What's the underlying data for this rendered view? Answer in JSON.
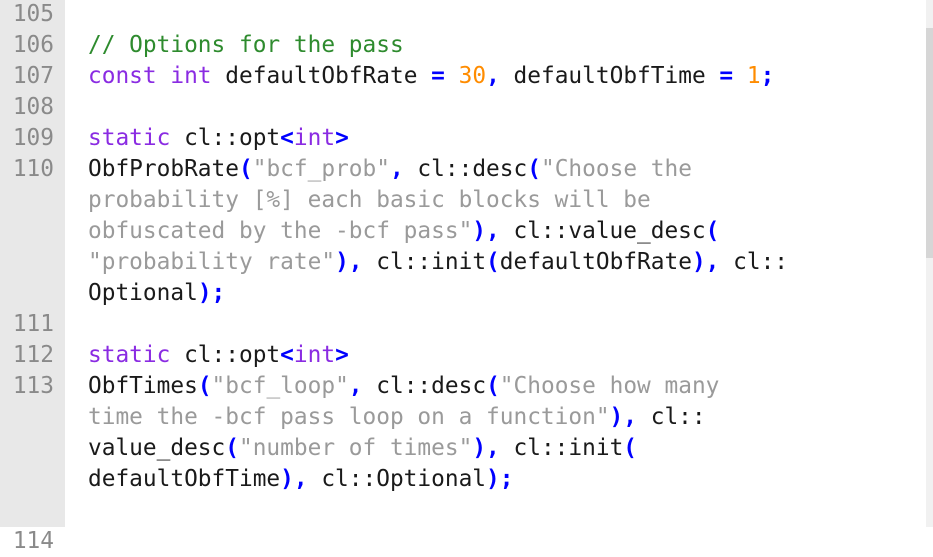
{
  "editor": {
    "lines": [
      {
        "number": "105",
        "tokens": []
      },
      {
        "number": "106",
        "tokens": [
          {
            "t": "cmt",
            "s": "// Options for the pass"
          }
        ]
      },
      {
        "number": "107",
        "tokens": [
          {
            "t": "kw",
            "s": "const"
          },
          {
            "t": "tx",
            "s": " "
          },
          {
            "t": "kw",
            "s": "int"
          },
          {
            "t": "tx",
            "s": " defaultObfRate "
          },
          {
            "t": "pn",
            "s": "="
          },
          {
            "t": "tx",
            "s": " "
          },
          {
            "t": "num",
            "s": "30"
          },
          {
            "t": "pn",
            "s": ","
          },
          {
            "t": "tx",
            "s": " defaultObfTime "
          },
          {
            "t": "pn",
            "s": "="
          },
          {
            "t": "tx",
            "s": " "
          },
          {
            "t": "num",
            "s": "1"
          },
          {
            "t": "pn",
            "s": ";"
          }
        ]
      },
      {
        "number": "108",
        "tokens": []
      },
      {
        "number": "109",
        "tokens": [
          {
            "t": "kw",
            "s": "static"
          },
          {
            "t": "tx",
            "s": " cl::opt"
          },
          {
            "t": "pn",
            "s": "<"
          },
          {
            "t": "kw",
            "s": "int"
          },
          {
            "t": "pn",
            "s": ">"
          }
        ]
      },
      {
        "number": "110",
        "tokens": [
          {
            "t": "tx",
            "s": "ObfProbRate"
          },
          {
            "t": "pn",
            "s": "("
          },
          {
            "t": "str",
            "s": "\"bcf_prob\""
          },
          {
            "t": "pn",
            "s": ","
          },
          {
            "t": "tx",
            "s": " cl::desc"
          },
          {
            "t": "pn",
            "s": "("
          },
          {
            "t": "str",
            "s": "\"Choose the"
          }
        ]
      },
      {
        "number": "",
        "tokens": [
          {
            "t": "str",
            "s": "probability [%] each basic blocks will be"
          }
        ]
      },
      {
        "number": "",
        "tokens": [
          {
            "t": "str",
            "s": "obfuscated by the -bcf pass\""
          },
          {
            "t": "pn",
            "s": "),"
          },
          {
            "t": "tx",
            "s": " cl::value_desc"
          },
          {
            "t": "pn",
            "s": "("
          }
        ]
      },
      {
        "number": "",
        "tokens": [
          {
            "t": "str",
            "s": "\"probability rate\""
          },
          {
            "t": "pn",
            "s": "),"
          },
          {
            "t": "tx",
            "s": " cl::init"
          },
          {
            "t": "pn",
            "s": "("
          },
          {
            "t": "tx",
            "s": "defaultObfRate"
          },
          {
            "t": "pn",
            "s": "),"
          },
          {
            "t": "tx",
            "s": " cl::"
          }
        ]
      },
      {
        "number": "",
        "tokens": [
          {
            "t": "tx",
            "s": "Optional"
          },
          {
            "t": "pn",
            "s": ");"
          }
        ]
      },
      {
        "number": "111",
        "tokens": []
      },
      {
        "number": "112",
        "tokens": [
          {
            "t": "kw",
            "s": "static"
          },
          {
            "t": "tx",
            "s": " cl::opt"
          },
          {
            "t": "pn",
            "s": "<"
          },
          {
            "t": "kw",
            "s": "int"
          },
          {
            "t": "pn",
            "s": ">"
          }
        ]
      },
      {
        "number": "113",
        "tokens": [
          {
            "t": "tx",
            "s": "ObfTimes"
          },
          {
            "t": "pn",
            "s": "("
          },
          {
            "t": "str",
            "s": "\"bcf_loop\""
          },
          {
            "t": "pn",
            "s": ","
          },
          {
            "t": "tx",
            "s": " cl::desc"
          },
          {
            "t": "pn",
            "s": "("
          },
          {
            "t": "str",
            "s": "\"Choose how many"
          }
        ]
      },
      {
        "number": "",
        "tokens": [
          {
            "t": "str",
            "s": "time the -bcf pass loop on a function\""
          },
          {
            "t": "pn",
            "s": "),"
          },
          {
            "t": "tx",
            "s": " cl::"
          }
        ]
      },
      {
        "number": "",
        "tokens": [
          {
            "t": "tx",
            "s": "value_desc"
          },
          {
            "t": "pn",
            "s": "("
          },
          {
            "t": "str",
            "s": "\"number of times\""
          },
          {
            "t": "pn",
            "s": "),"
          },
          {
            "t": "tx",
            "s": " cl::init"
          },
          {
            "t": "pn",
            "s": "("
          }
        ]
      },
      {
        "number": "",
        "tokens": [
          {
            "t": "tx",
            "s": "defaultObfTime"
          },
          {
            "t": "pn",
            "s": "),"
          },
          {
            "t": "tx",
            "s": " cl::Optional"
          },
          {
            "t": "pn",
            "s": ");"
          }
        ]
      },
      {
        "number": "",
        "tokens": []
      },
      {
        "number": "114",
        "tokens": []
      }
    ]
  },
  "colors": {
    "gutter_bg": "#e8e8e8",
    "line_number": "#8a8a8a",
    "comment": "#2e8b2e",
    "keyword": "#8a2be2",
    "number": "#ff8c00",
    "string": "#9a9a9a",
    "punctuation": "#0000ff",
    "text": "#1a1a1a"
  }
}
